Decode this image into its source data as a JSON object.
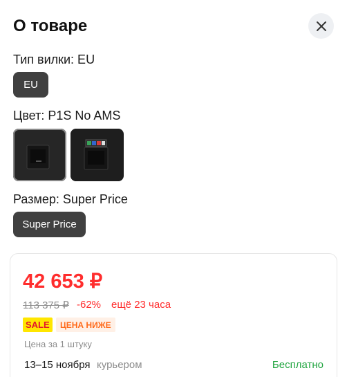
{
  "header": {
    "title": "О товаре"
  },
  "plug": {
    "label": "Тип вилки: EU",
    "options": [
      "EU"
    ]
  },
  "color": {
    "label": "Цвет: P1S No AMS"
  },
  "size": {
    "label": "Размер: Super Price",
    "options": [
      "Super Price"
    ]
  },
  "price_card": {
    "price": "42 653 ₽",
    "old_price": "113 375 ₽",
    "discount": "-62%",
    "timer": "ещё 23 часа",
    "badge_sale": "SALE",
    "badge_lower": "ЦЕНА НИЖЕ",
    "unit_price": "Цена за 1 штуку",
    "delivery_date": "13–15 ноября",
    "delivery_method": "курьером",
    "delivery_price": "Бесплатно"
  },
  "colors": {
    "accent_red": "#ff2d2d",
    "chip_bg": "#404040",
    "free_green": "#23a642",
    "sale_yellow": "#ffe600"
  }
}
